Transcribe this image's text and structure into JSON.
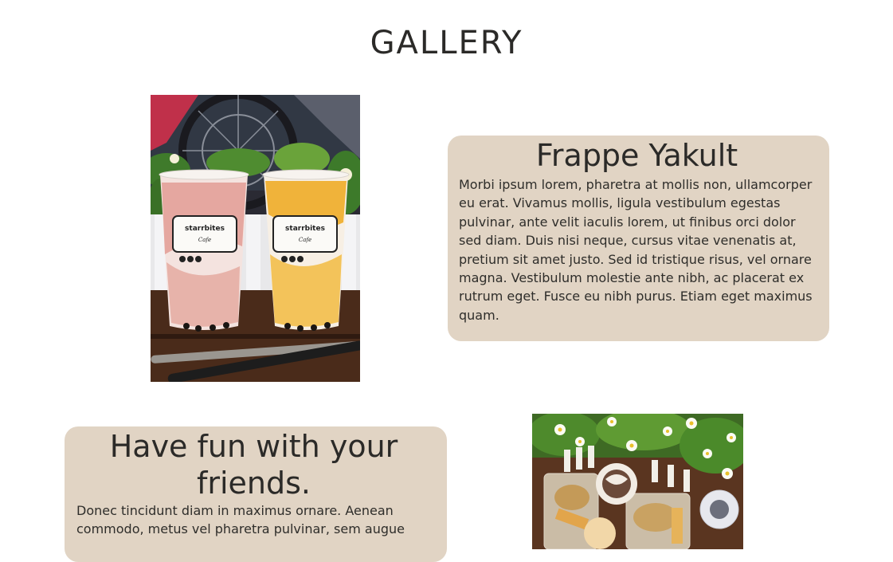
{
  "page": {
    "title": "GALLERY"
  },
  "items": [
    {
      "title": "Frappe Yakult",
      "body": "Morbi ipsum lorem, pharetra at mollis non, ullamcorper eu erat. Vivamus mollis, ligula vestibulum egestas pulvinar, ante velit iaculis lorem, ut finibus orci dolor sed diam. Duis nisi neque, cursus vitae venenatis at, pretium sit amet justo. Sed id tristique risus, vel ornare magna. Vestibulum molestie ante nibh, ac placerat ex rutrum eget. Fusce eu nibh purus. Etiam eget maximus quam."
    },
    {
      "title": "Have fun with your friends.",
      "body": "Donec tincidunt diam in maximus ornare. Aenean commodo, metus vel pharetra pulvinar, sem augue"
    }
  ],
  "photos": [
    {
      "cup_label": "starrbites",
      "cup_sub": "Cafe"
    }
  ],
  "colors": {
    "card_bg": "#e1d4c4",
    "text": "#2b2a28"
  }
}
